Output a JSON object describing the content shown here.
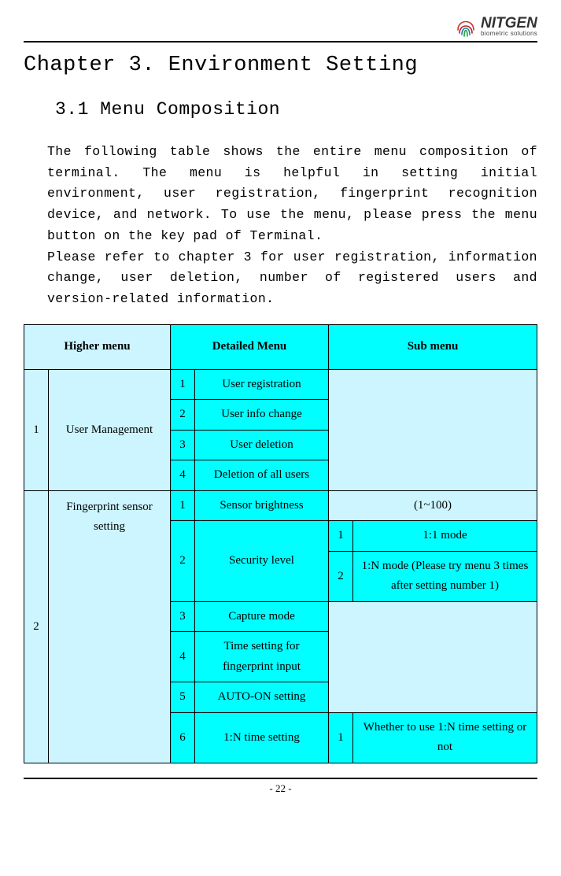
{
  "logo": {
    "name": "NITGEN",
    "tag": "biometric solutions"
  },
  "chapter_title": "Chapter 3. Environment Setting",
  "section_title": "3.1 Menu Composition",
  "body_para": "The following table shows the entire menu composition of terminal. The menu is helpful in setting initial environment, user registration, fingerprint recognition device, and network. To use the menu, please press the menu button on the key pad of Terminal.\nPlease refer to chapter 3 for user registration, information change, user deletion, number of registered users and version-related information.",
  "table": {
    "headers": {
      "higher": "Higher menu",
      "detailed": "Detailed Menu",
      "sub": "Sub menu"
    },
    "group1": {
      "num": "1",
      "name": "User\nManagement",
      "rows": [
        {
          "n": "1",
          "label": "User registration"
        },
        {
          "n": "2",
          "label": "User info change"
        },
        {
          "n": "3",
          "label": "User deletion"
        },
        {
          "n": "4",
          "label": "Deletion of all users"
        }
      ]
    },
    "group2": {
      "num": "2",
      "name": "Fingerprint\nsensor setting",
      "rows": {
        "r1": {
          "n": "1",
          "label": "Sensor brightness",
          "sub": "(1~100)"
        },
        "r2": {
          "n": "2",
          "label": "Security level",
          "s1": {
            "n": "1",
            "label": "1:1 mode"
          },
          "s2": {
            "n": "2",
            "label": "1:N mode\n(Please try menu 3\ntimes after setting\nnumber 1)"
          }
        },
        "r3": {
          "n": "3",
          "label": "Capture mode"
        },
        "r4": {
          "n": "4",
          "label": "Time setting for\nfingerprint input"
        },
        "r5": {
          "n": "5",
          "label": "AUTO-ON setting"
        },
        "r6": {
          "n": "6",
          "label": "1:N time setting",
          "s1": {
            "n": "1",
            "label": "Whether to use 1:N\ntime setting or not"
          }
        }
      }
    }
  },
  "footer": "- 22 -",
  "chart_data": {
    "type": "table",
    "title": "Menu Composition",
    "columns": [
      "Higher menu",
      "Detailed Menu",
      "Sub menu"
    ],
    "rows": [
      [
        "1 User Management",
        "1 User registration",
        ""
      ],
      [
        "1 User Management",
        "2 User info change",
        ""
      ],
      [
        "1 User Management",
        "3 User deletion",
        ""
      ],
      [
        "1 User Management",
        "4 Deletion of all users",
        ""
      ],
      [
        "2 Fingerprint sensor setting",
        "1 Sensor brightness",
        "(1~100)"
      ],
      [
        "2 Fingerprint sensor setting",
        "2 Security level",
        "1 1:1 mode"
      ],
      [
        "2 Fingerprint sensor setting",
        "2 Security level",
        "2 1:N mode (Please try menu 3 times after setting number 1)"
      ],
      [
        "2 Fingerprint sensor setting",
        "3 Capture mode",
        ""
      ],
      [
        "2 Fingerprint sensor setting",
        "4 Time setting for fingerprint input",
        ""
      ],
      [
        "2 Fingerprint sensor setting",
        "5 AUTO-ON setting",
        ""
      ],
      [
        "2 Fingerprint sensor setting",
        "6 1:N time setting",
        "1 Whether to use 1:N time setting or not"
      ]
    ]
  }
}
